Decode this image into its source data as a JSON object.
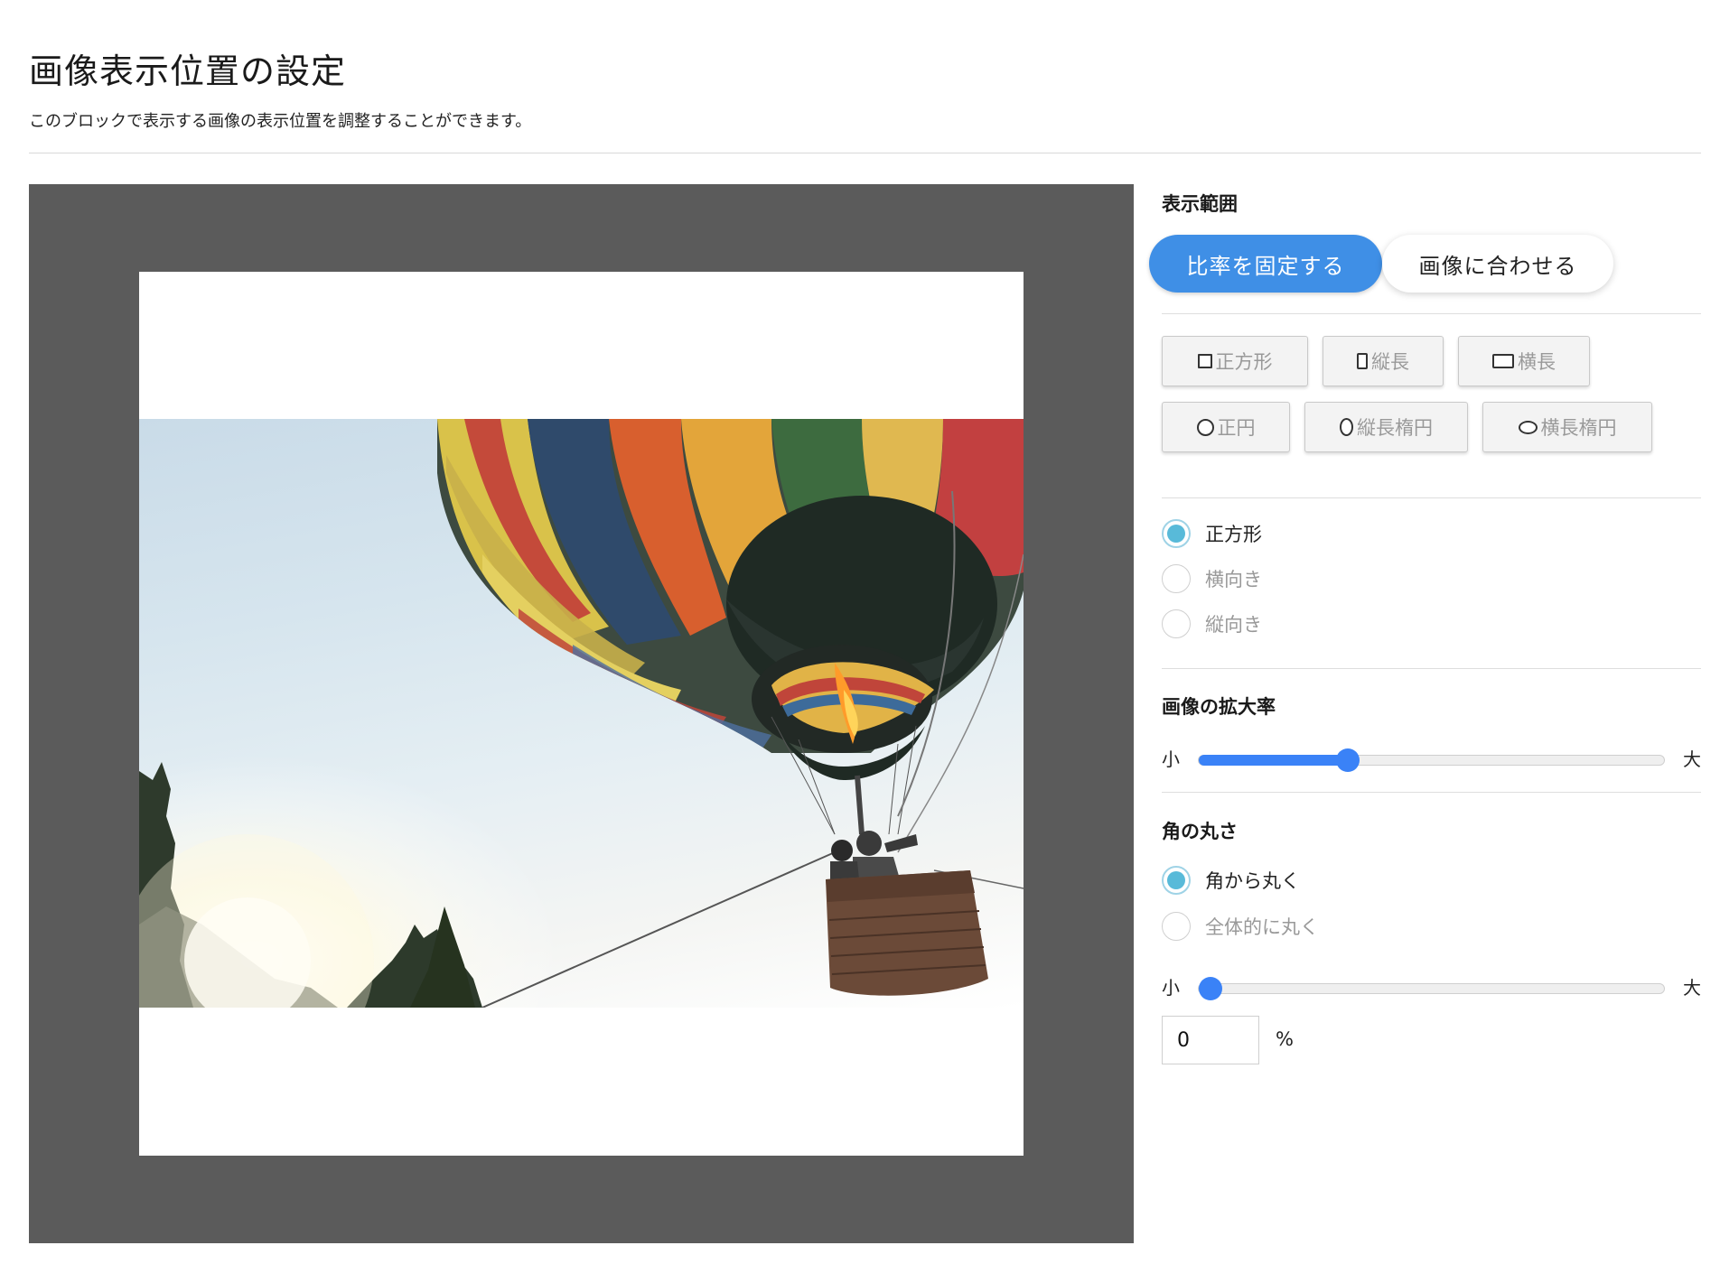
{
  "header": {
    "title": "画像表示位置の設定",
    "subtitle": "このブロックで表示する画像の表示位置を調整することができます。"
  },
  "panel": {
    "display_range": {
      "label": "表示範囲",
      "buttons": [
        {
          "label": "比率を固定する",
          "active": true
        },
        {
          "label": "画像に合わせる",
          "active": false
        }
      ]
    },
    "shapes": [
      {
        "label": "正方形",
        "icon": "square-icon"
      },
      {
        "label": "縦長",
        "icon": "portrait-rect-icon"
      },
      {
        "label": "横長",
        "icon": "landscape-rect-icon"
      },
      {
        "label": "正円",
        "icon": "circle-icon"
      },
      {
        "label": "縦長楕円",
        "icon": "vertical-ellipse-icon"
      },
      {
        "label": "横長楕円",
        "icon": "horizontal-ellipse-icon"
      }
    ],
    "orientation": [
      {
        "label": "正方形",
        "checked": true
      },
      {
        "label": "横向き",
        "checked": false
      },
      {
        "label": "縦向き",
        "checked": false
      }
    ],
    "zoom": {
      "label": "画像の拡大率",
      "min_label": "小",
      "max_label": "大",
      "value_fraction": 0.32
    },
    "corner": {
      "label": "角の丸さ",
      "options": [
        {
          "label": "角から丸く",
          "checked": true
        },
        {
          "label": "全体的に丸く",
          "checked": false
        }
      ],
      "min_label": "小",
      "max_label": "大",
      "value_fraction": 0.0,
      "input_value": "0",
      "unit": "%"
    }
  },
  "colors": {
    "accent": "#3f8fe6",
    "radio_checked": "#58bad9",
    "slider": "#3a82f7",
    "preview_bg": "#5b5b5b"
  }
}
